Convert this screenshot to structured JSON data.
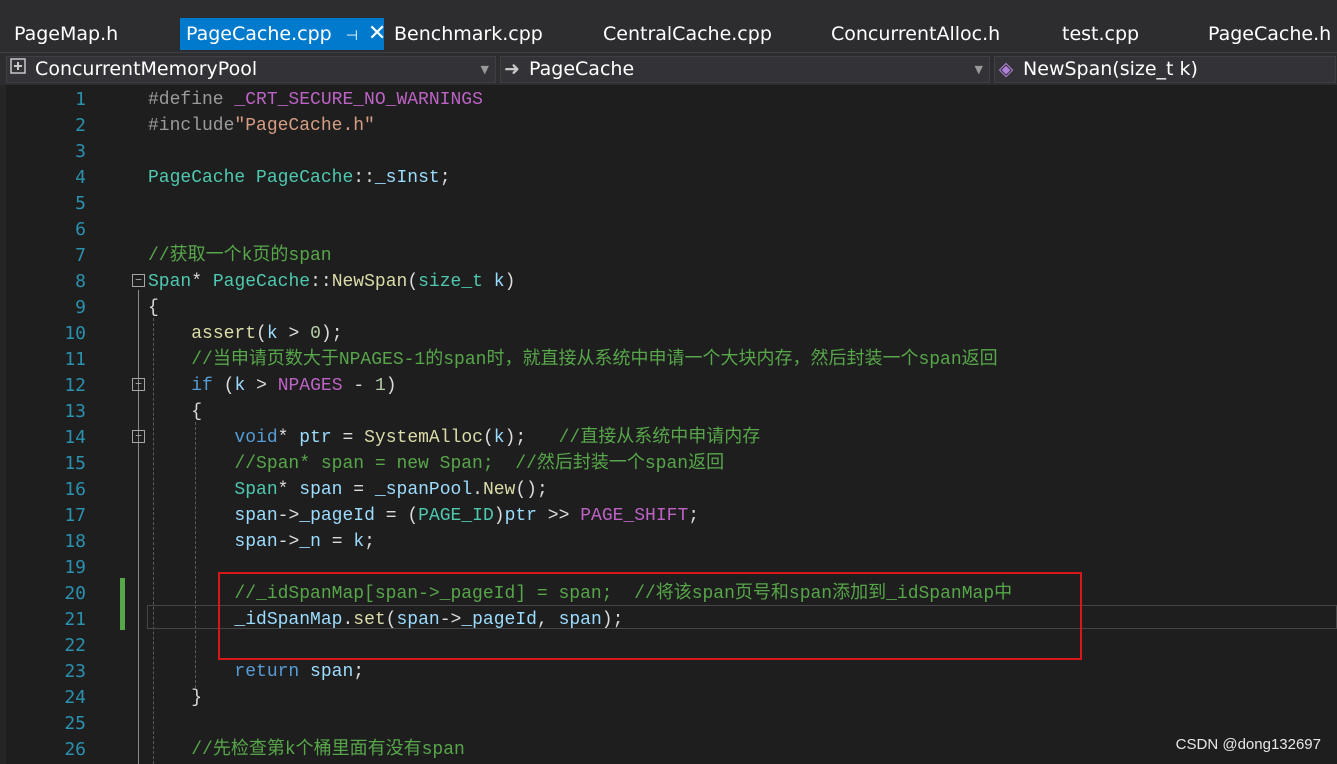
{
  "tabs": [
    {
      "label": "PageMap.h"
    },
    {
      "label": "PageCache.cpp",
      "active": true,
      "pin": "⊣",
      "close": "✕"
    },
    {
      "label": "Benchmark.cpp"
    },
    {
      "label": "CentralCache.cpp"
    },
    {
      "label": "ConcurrentAlloc.h"
    },
    {
      "label": "test.cpp"
    },
    {
      "label": "PageCache.h"
    }
  ],
  "nav": {
    "project": "ConcurrentMemoryPool",
    "scope": "PageCache",
    "member": "NewSpan(size_t k)"
  },
  "code_lines": [
    "#define _CRT_SECURE_NO_WARNINGS",
    "#include\"PageCache.h\"",
    "",
    "PageCache PageCache::_sInst;",
    "",
    "",
    "//获取一个k页的span",
    "Span* PageCache::NewSpan(size_t k)",
    "{",
    "    assert(k > 0);",
    "    //当申请页数大于NPAGES-1的span时，就直接从系统中申请一个大块内存，然后封装一个span返回",
    "    if (k > NPAGES - 1)",
    "    {",
    "        void* ptr = SystemAlloc(k);   //直接从系统中申请内存",
    "        //Span* span = new Span;  //然后封装一个span返回",
    "        Span* span = _spanPool.New();",
    "        span->_pageId = (PAGE_ID)ptr >> PAGE_SHIFT;",
    "        span->_n = k;",
    "",
    "        //_idSpanMap[span->_pageId] = span;  //将该span页号和span添加到_idSpanMap中",
    "        _idSpanMap.set(span->_pageId, span);",
    "",
    "        return span;",
    "    }",
    "",
    "    //先检查第k个桶里面有没有span"
  ],
  "line_numbers": [
    "1",
    "2",
    "3",
    "4",
    "5",
    "6",
    "7",
    "8",
    "9",
    "10",
    "11",
    "12",
    "13",
    "14",
    "15",
    "16",
    "17",
    "18",
    "19",
    "20",
    "21",
    "22",
    "23",
    "24",
    "25",
    "26"
  ],
  "watermark": "CSDN @dong132697",
  "colors": {
    "keyword": "#569cd6",
    "type": "#4ec9b0",
    "function": "#dcdcaa",
    "comment": "#57a64a",
    "string": "#d69d85",
    "macro": "#bd63c5",
    "line_number": "#2b91af",
    "highlight_box": "#d6181d",
    "active_tab": "#007acc"
  },
  "icons": {
    "project": "project-icon",
    "scope": "arrow-right-icon",
    "member": "method-icon"
  }
}
